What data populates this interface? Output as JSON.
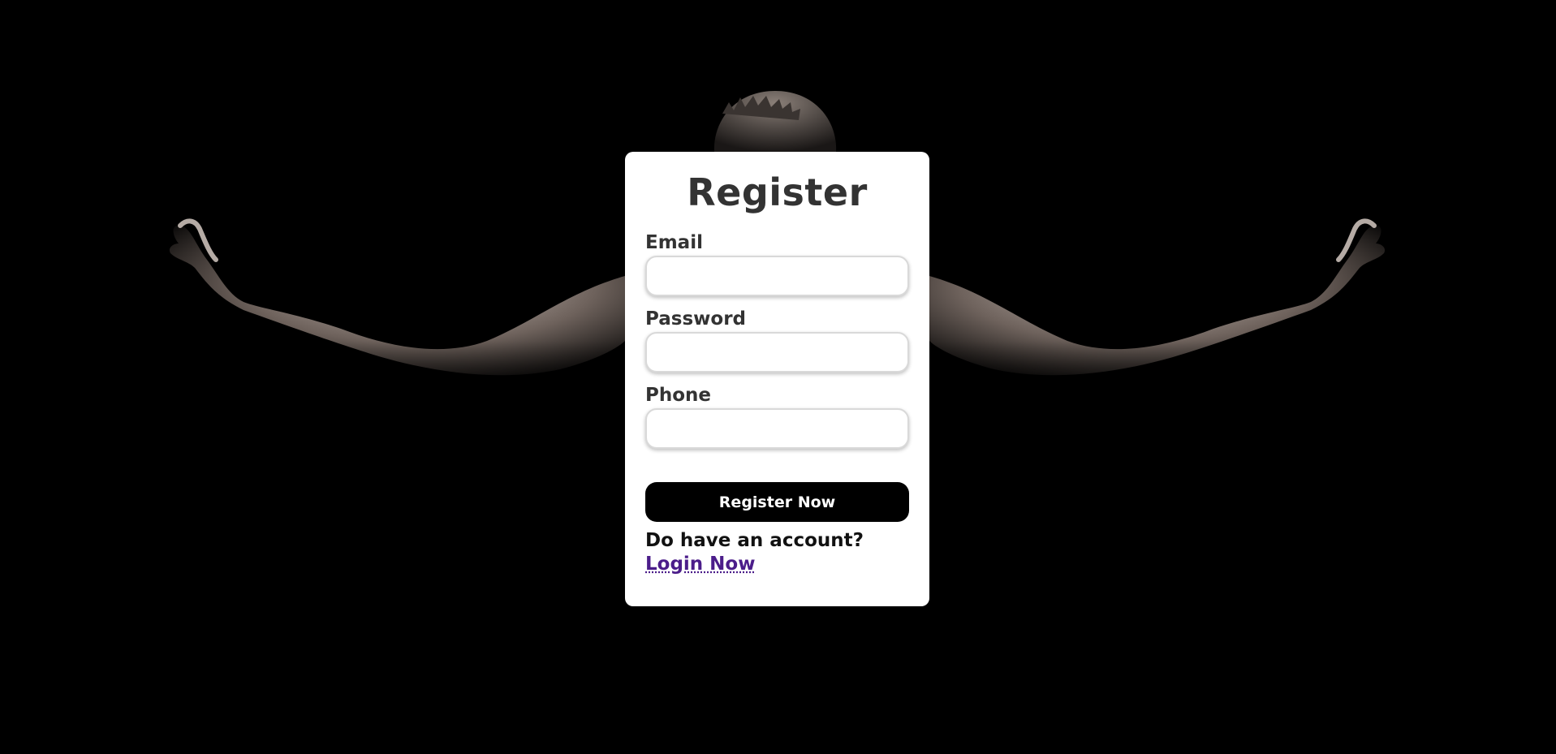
{
  "page": {
    "background_color": "#000000",
    "card_color": "#ffffff",
    "link_color": "#4b1d8a"
  },
  "form": {
    "title": "Register",
    "fields": [
      {
        "label": "Email",
        "value": "",
        "placeholder": ""
      },
      {
        "label": "Password",
        "value": "",
        "placeholder": ""
      },
      {
        "label": "Phone",
        "value": "",
        "placeholder": ""
      }
    ],
    "submit_label": "Register Now",
    "account_prompt": "Do have an account? ",
    "login_link": "Login Now"
  },
  "background_image": {
    "subject": "muscular-man-silhouette-icon"
  }
}
